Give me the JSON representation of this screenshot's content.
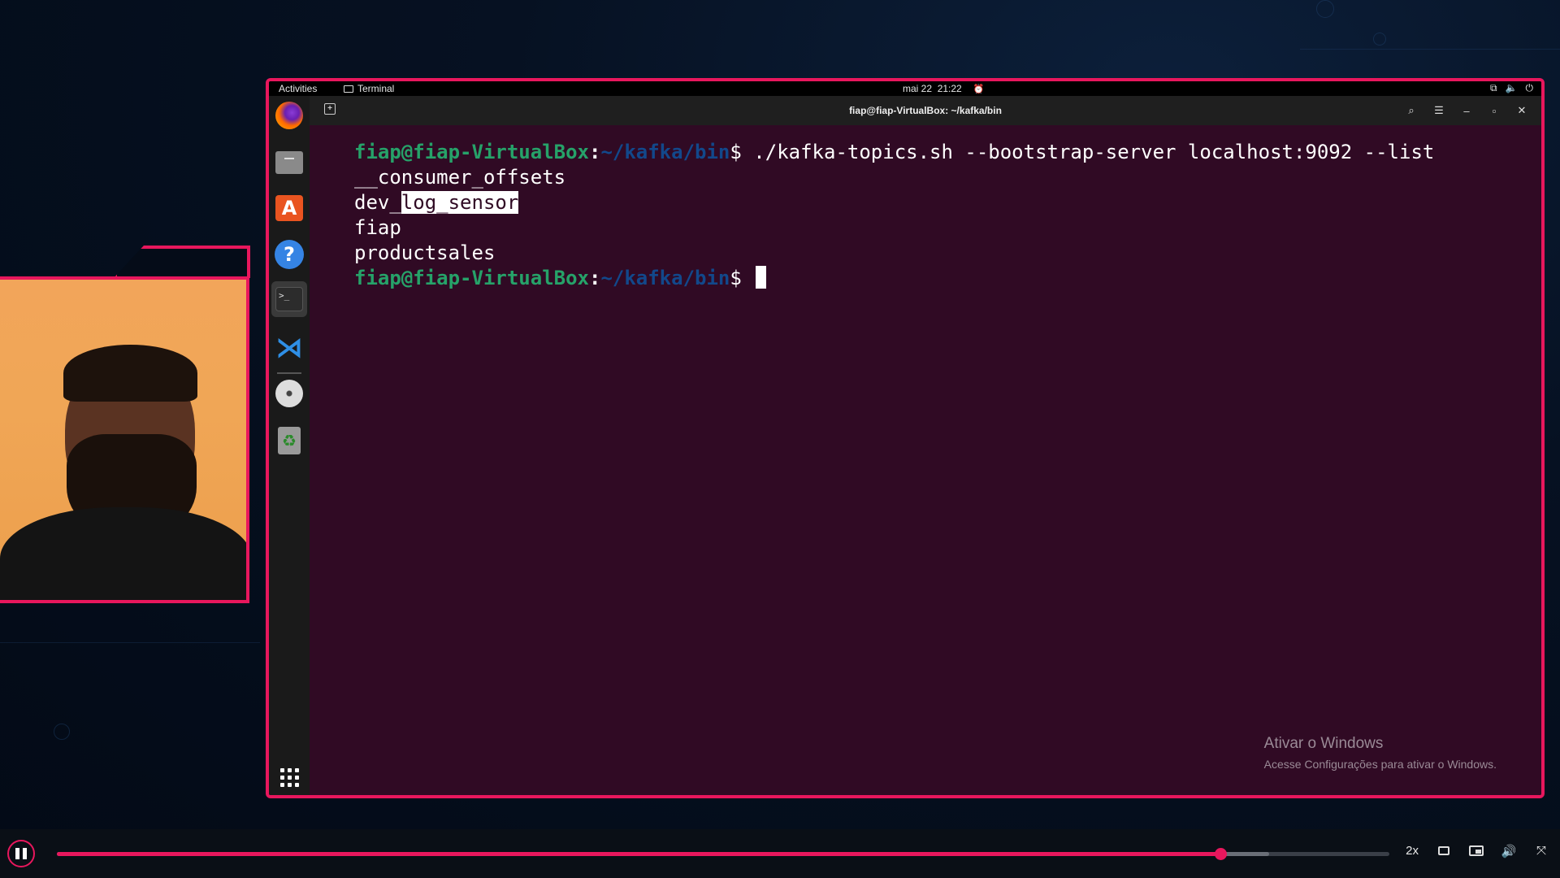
{
  "ubuntu_top_bar": {
    "activities": "Activities",
    "app_name": "Terminal",
    "date": "mai 22",
    "time": "21:22"
  },
  "terminal": {
    "window_title": "fiap@fiap-VirtualBox: ~/kafka/bin",
    "prompt_user": "fiap@fiap-VirtualBox",
    "prompt_colon": ":",
    "prompt_path": "~/kafka/bin",
    "prompt_dollar": "$ ",
    "command": "./kafka-topics.sh --bootstrap-server localhost:9092 --list",
    "output": {
      "line1": "__consumer_offsets",
      "line2_prefix": "dev_",
      "line2_selected": "log_sensor",
      "line3": "fiap",
      "line4": "productsales"
    }
  },
  "dock": {
    "icons": [
      "firefox-icon",
      "files-icon",
      "software-store-icon",
      "help-icon",
      "terminal-icon",
      "vscode-icon",
      "dvd-icon",
      "trash-icon",
      "apps-grid-icon"
    ],
    "terminal_glyph": ">_"
  },
  "windows_watermark": {
    "title": "Ativar o Windows",
    "subtitle": "Acesse Configurações para ativar o Windows."
  },
  "video_player": {
    "speed_label": "2x",
    "progress": 0.873,
    "buffered": 0.91,
    "accent_color": "#e8175d"
  },
  "colors": {
    "frame_accent": "#e8175d",
    "terminal_bg": "#300a24",
    "prompt_user": "#26a269",
    "prompt_path": "#12488b"
  }
}
